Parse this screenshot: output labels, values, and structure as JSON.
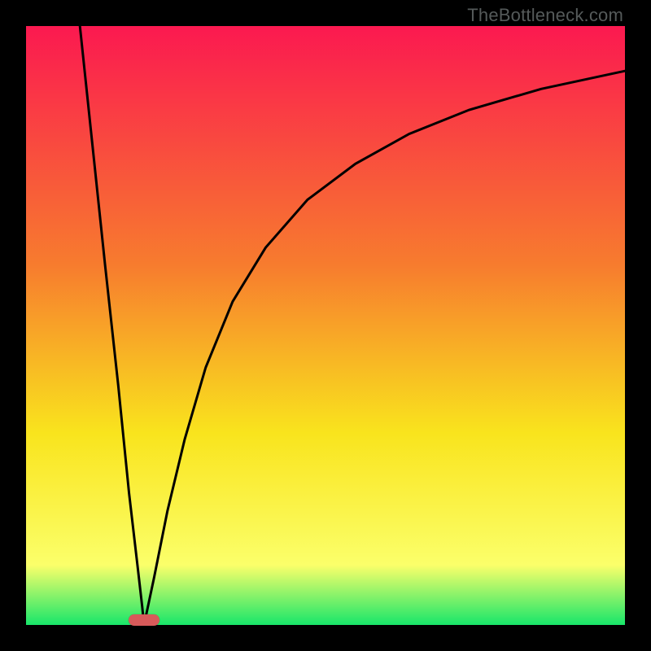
{
  "attribution": {
    "watermark": "TheBottleneck.com"
  },
  "colors": {
    "gradient_top": "#fb1950",
    "gradient_mid1": "#f77c2e",
    "gradient_mid2": "#f9e41d",
    "gradient_mid3": "#fbff6a",
    "gradient_bottom": "#18e66a",
    "optimum_marker": "#d75a5a"
  },
  "chart_data": {
    "type": "line",
    "title": "",
    "xlabel": "",
    "ylabel": "",
    "xlim": [
      0,
      100
    ],
    "ylim": [
      0,
      100
    ],
    "annotations": [
      {
        "name": "optimum-marker",
        "x": 19.7,
        "y": 0
      }
    ],
    "series": [
      {
        "name": "left-branch",
        "x": [
          9.0,
          11.1,
          13.2,
          15.4,
          17.2,
          18.6,
          19.4,
          19.7
        ],
        "values": [
          100,
          80,
          60,
          40,
          22,
          10,
          3,
          0
        ]
      },
      {
        "name": "right-branch",
        "x": [
          19.7,
          21.4,
          23.6,
          26.5,
          30.0,
          34.5,
          40.0,
          47.0,
          55.0,
          64.0,
          74.0,
          86.0,
          100.0
        ],
        "values": [
          0,
          8,
          19,
          31,
          43,
          54,
          63,
          71,
          77,
          82,
          86,
          89.5,
          92.5
        ]
      }
    ]
  }
}
